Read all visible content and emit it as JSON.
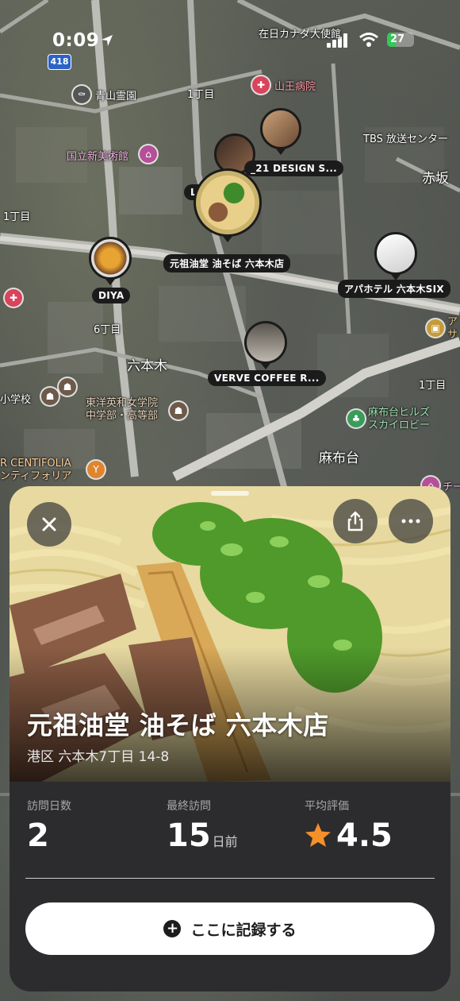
{
  "status_bar": {
    "time": "0:09",
    "battery": "27",
    "icons": [
      "location-arrow-icon",
      "cellular-icon",
      "wifi-icon",
      "battery-icon"
    ]
  },
  "map": {
    "route_number": "418",
    "labels": {
      "aoyama_cemetery": "青山霊園",
      "itchome_top": "1丁目",
      "sanno_hospital": "山王病院",
      "canada_embassy": "在日カナダ大使館",
      "tbs": "TBS 放送センター",
      "national_art_center": "国立新美術館",
      "akasaka": "赤坂",
      "itchome_left": "1丁目",
      "rokuchome": "6丁目",
      "roppongi": "六本木",
      "toyo_eiwa": "東洋英和女学院\n中学部・高等部",
      "shogakko": "小学校",
      "centifolia": "R CENTIFOLIA\nンティフォリア",
      "azabudai": "麻布台",
      "azabudai_hills": "麻布台ヒルズ\nスカイロビー",
      "itchome_right": "1丁目",
      "right_edge_1": "ア\nサ",
      "right_edge_2": "チー"
    },
    "pins": {
      "main": "元祖油堂 油そば 六本木店",
      "diya": "DIYA",
      "design": "_21 DESIGN S...",
      "lid": "L        id...",
      "apa": "アパホテル 六本木SIX",
      "verve": "VERVE COFFEE R..."
    }
  },
  "sheet": {
    "title": "元祖油堂 油そば 六本木店",
    "address": "港区 六本木7丁目 14-8",
    "stats": {
      "visits_label": "訪問日数",
      "visits_value": "2",
      "last_label": "最終訪問",
      "last_value": "15",
      "last_unit": "日前",
      "rating_label": "平均評価",
      "rating_value": "4.5"
    },
    "cta_label": "ここに記録する",
    "buttons": [
      "close-icon",
      "share-icon",
      "more-icon"
    ]
  },
  "colors": {
    "star": "#f5902a",
    "sheet_bg": "#2c2c2e",
    "pin_border": "#1b1b1b",
    "battery_green": "#34c759",
    "route_shield": "#2b63c7"
  }
}
